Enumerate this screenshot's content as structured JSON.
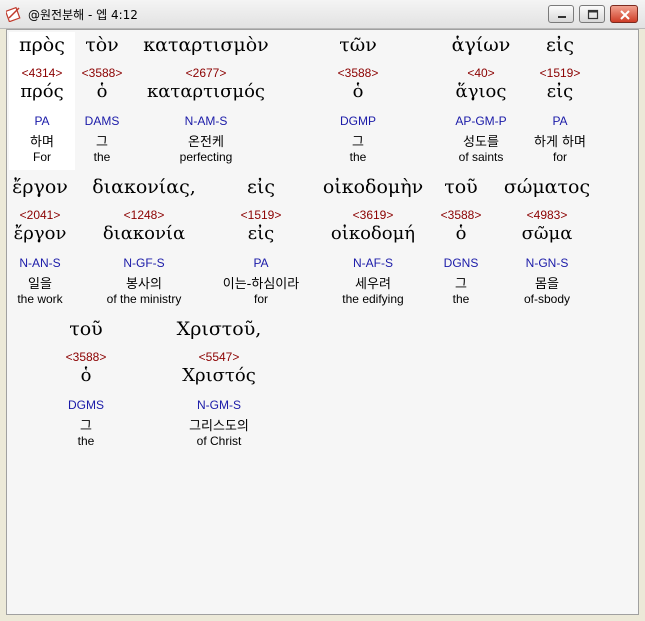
{
  "window": {
    "title": "@원전분해 - 엡 4:12"
  },
  "words": [
    {
      "greek": "πρὸς",
      "strong": "<4314>",
      "lemma": "πρός",
      "parse": "PA",
      "korean": "하며",
      "english": "For"
    },
    {
      "greek": "τὸν",
      "strong": "<3588>",
      "lemma": "ὁ",
      "parse": "DAMS",
      "korean": "그",
      "english": "the"
    },
    {
      "greek": "καταρτισμὸν",
      "strong": "<2677>",
      "lemma": "καταρτισμός",
      "parse": "N-AM-S",
      "korean": "온전케",
      "english": "perfecting"
    },
    {
      "greek": "τῶν",
      "strong": "<3588>",
      "lemma": "ὁ",
      "parse": "DGMP",
      "korean": "그",
      "english": "the"
    },
    {
      "greek": "ἁγίων",
      "strong": "<40>",
      "lemma": "ἅγιος",
      "parse": "AP-GM-P",
      "korean": "성도를",
      "english": "of saints"
    },
    {
      "greek": "εἰς",
      "strong": "<1519>",
      "lemma": "εἰς",
      "parse": "PA",
      "korean": "하게 하며",
      "english": "for"
    },
    {
      "greek": "ἔργον",
      "strong": "<2041>",
      "lemma": "ἔργον",
      "parse": "N-AN-S",
      "korean": "일을",
      "english": "the work"
    },
    {
      "greek": "διακονίας,",
      "strong": "<1248>",
      "lemma": "διακονία",
      "parse": "N-GF-S",
      "korean": "봉사의",
      "english": "of the ministry"
    },
    {
      "greek": "εἰς",
      "strong": "<1519>",
      "lemma": "εἰς",
      "parse": "PA",
      "korean": "이는-하심이라",
      "english": "for"
    },
    {
      "greek": "οἰκοδομὴν",
      "strong": "<3619>",
      "lemma": "οἰκοδομή",
      "parse": "N-AF-S",
      "korean": "세우려",
      "english": "the edifying"
    },
    {
      "greek": "τοῦ",
      "strong": "<3588>",
      "lemma": "ὁ",
      "parse": "DGNS",
      "korean": "그",
      "english": "the"
    },
    {
      "greek": "σώματος",
      "strong": "<4983>",
      "lemma": "σῶμα",
      "parse": "N-GN-S",
      "korean": "몸을",
      "english": "of-sbody"
    },
    {
      "greek": "τοῦ",
      "strong": "<3588>",
      "lemma": "ὁ",
      "parse": "DGMS",
      "korean": "그",
      "english": "the"
    },
    {
      "greek": "Χριστοῦ,",
      "strong": "<5547>",
      "lemma": "Χριστός",
      "parse": "N-GM-S",
      "korean": "그리스도의",
      "english": "of Christ"
    }
  ]
}
